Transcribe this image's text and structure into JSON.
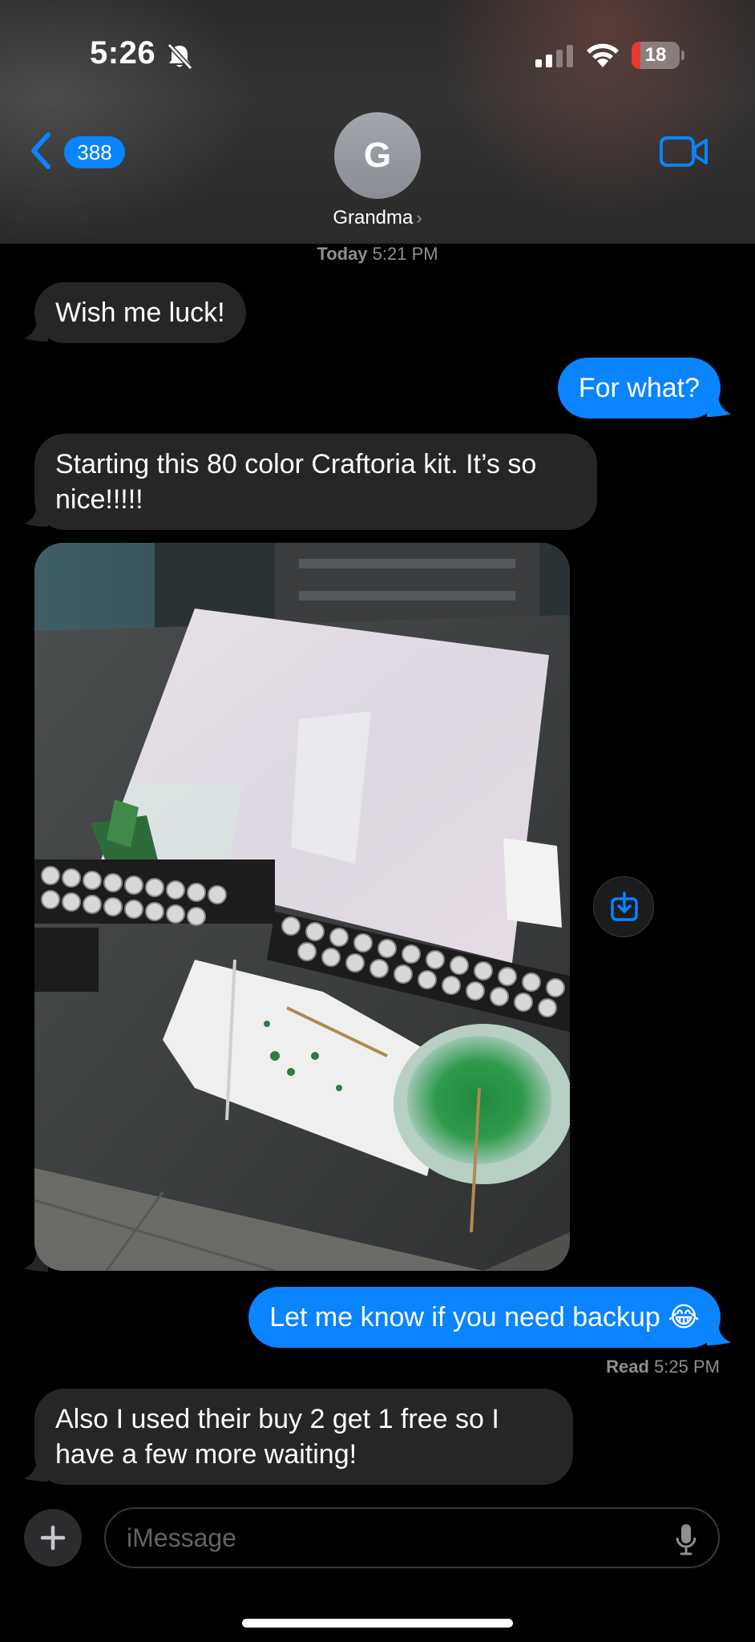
{
  "status_bar": {
    "time": "5:26",
    "battery_level": "18",
    "battery_fraction": 0.18,
    "icons": [
      "bell-slash-icon",
      "cellular-signal-icon",
      "wifi-icon",
      "battery-icon"
    ]
  },
  "header": {
    "back_count": "388",
    "avatar_initial": "G",
    "contact_name": "Grandma",
    "contact_chevron": "›",
    "video_icon": "video-camera-icon"
  },
  "conversation": {
    "timestamp_day": "Today",
    "timestamp_time": "5:21 PM",
    "messages": [
      {
        "direction": "incoming",
        "text": "Wish me luck!"
      },
      {
        "direction": "outgoing",
        "text": "For what?"
      },
      {
        "direction": "incoming",
        "text": "Starting this 80 color Craftoria kit. It’s so nice!!!!!"
      },
      {
        "direction": "incoming",
        "type": "photo"
      },
      {
        "direction": "outgoing",
        "text": "Let me know if you need backup 😂"
      },
      {
        "direction": "incoming",
        "text": "Also I used their buy 2 get 1 free so I have a few more waiting!"
      }
    ],
    "read_label": "Read",
    "read_time": "5:25 PM",
    "save_icon": "save-to-photos-icon"
  },
  "composer": {
    "placeholder": "iMessage",
    "plus_icon": "plus-icon",
    "mic_icon": "microphone-icon"
  },
  "colors": {
    "outgoing_bubble": "#0a84ff",
    "incoming_bubble": "#262629",
    "accent": "#0a84ff",
    "battery_low": "#e5392f"
  }
}
